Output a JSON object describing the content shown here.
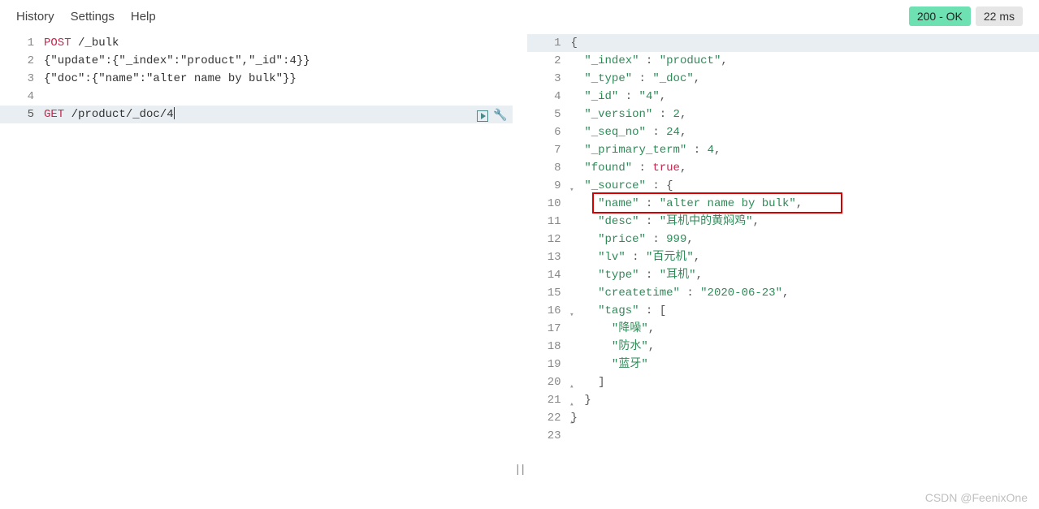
{
  "menu": {
    "history": "History",
    "settings": "Settings",
    "help": "Help"
  },
  "status": {
    "ok": "200 - OK",
    "time": "22 ms"
  },
  "left": {
    "lines": [
      "1",
      "2",
      "3",
      "4",
      "5"
    ],
    "l1_method": "POST",
    "l1_path": " /_bulk",
    "l2": "{\"update\":{\"_index\":\"product\",\"_id\":4}}",
    "l3": "{\"doc\":{\"name\":\"alter name by bulk\"}}",
    "l5_method": "GET",
    "l5_path": " /product/_doc/4"
  },
  "right": {
    "lines": [
      "1",
      "2",
      "3",
      "4",
      "5",
      "6",
      "7",
      "8",
      "9",
      "10",
      "11",
      "12",
      "13",
      "14",
      "15",
      "16",
      "17",
      "18",
      "19",
      "20",
      "21",
      "22",
      "23"
    ],
    "l1": "{",
    "l2_k": "\"_index\"",
    "l2_v": "\"product\"",
    "l3_k": "\"_type\"",
    "l3_v": "\"_doc\"",
    "l4_k": "\"_id\"",
    "l4_v": "\"4\"",
    "l5_k": "\"_version\"",
    "l5_v": "2",
    "l6_k": "\"_seq_no\"",
    "l6_v": "24",
    "l7_k": "\"_primary_term\"",
    "l7_v": "4",
    "l8_k": "\"found\"",
    "l8_v": "true",
    "l9_k": "\"_source\"",
    "l10_k": "\"name\"",
    "l10_v": "\"alter name by bulk\"",
    "l11_k": "\"desc\"",
    "l11_v": "\"耳机中的黄焖鸡\"",
    "l12_k": "\"price\"",
    "l12_v": "999",
    "l13_k": "\"lv\"",
    "l13_v": "\"百元机\"",
    "l14_k": "\"type\"",
    "l14_v": "\"耳机\"",
    "l15_k": "\"createtime\"",
    "l15_v": "\"2020-06-23\"",
    "l16_k": "\"tags\"",
    "l17_v": "\"降噪\"",
    "l18_v": "\"防水\"",
    "l19_v": "\"蓝牙\"",
    "l20": "]",
    "l21": "}",
    "l22": "}"
  },
  "watermark": "CSDN @FeenixOne",
  "colon": " : ",
  "comma": ","
}
